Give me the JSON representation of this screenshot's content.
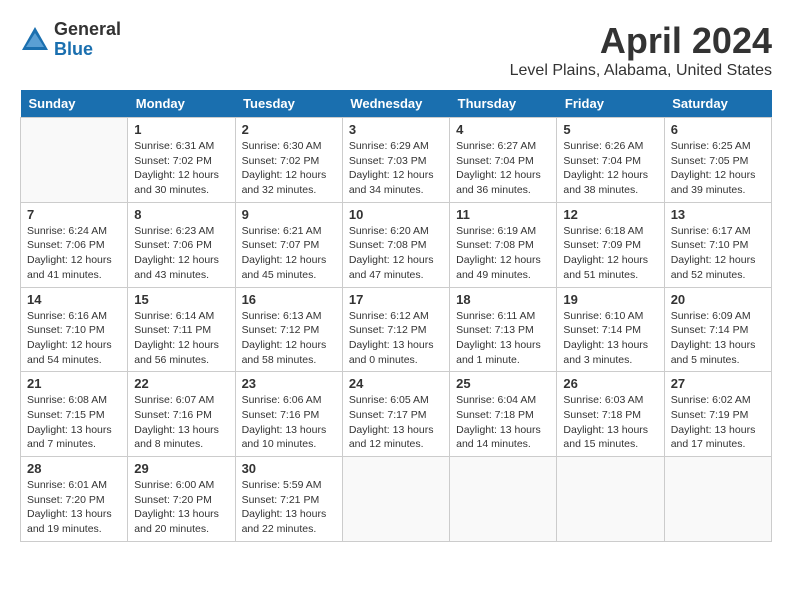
{
  "logo": {
    "general": "General",
    "blue": "Blue"
  },
  "title": "April 2024",
  "location": "Level Plains, Alabama, United States",
  "days_of_week": [
    "Sunday",
    "Monday",
    "Tuesday",
    "Wednesday",
    "Thursday",
    "Friday",
    "Saturday"
  ],
  "weeks": [
    [
      {
        "day": "",
        "sunrise": "",
        "sunset": "",
        "daylight": ""
      },
      {
        "day": "1",
        "sunrise": "Sunrise: 6:31 AM",
        "sunset": "Sunset: 7:02 PM",
        "daylight": "Daylight: 12 hours and 30 minutes."
      },
      {
        "day": "2",
        "sunrise": "Sunrise: 6:30 AM",
        "sunset": "Sunset: 7:02 PM",
        "daylight": "Daylight: 12 hours and 32 minutes."
      },
      {
        "day": "3",
        "sunrise": "Sunrise: 6:29 AM",
        "sunset": "Sunset: 7:03 PM",
        "daylight": "Daylight: 12 hours and 34 minutes."
      },
      {
        "day": "4",
        "sunrise": "Sunrise: 6:27 AM",
        "sunset": "Sunset: 7:04 PM",
        "daylight": "Daylight: 12 hours and 36 minutes."
      },
      {
        "day": "5",
        "sunrise": "Sunrise: 6:26 AM",
        "sunset": "Sunset: 7:04 PM",
        "daylight": "Daylight: 12 hours and 38 minutes."
      },
      {
        "day": "6",
        "sunrise": "Sunrise: 6:25 AM",
        "sunset": "Sunset: 7:05 PM",
        "daylight": "Daylight: 12 hours and 39 minutes."
      }
    ],
    [
      {
        "day": "7",
        "sunrise": "Sunrise: 6:24 AM",
        "sunset": "Sunset: 7:06 PM",
        "daylight": "Daylight: 12 hours and 41 minutes."
      },
      {
        "day": "8",
        "sunrise": "Sunrise: 6:23 AM",
        "sunset": "Sunset: 7:06 PM",
        "daylight": "Daylight: 12 hours and 43 minutes."
      },
      {
        "day": "9",
        "sunrise": "Sunrise: 6:21 AM",
        "sunset": "Sunset: 7:07 PM",
        "daylight": "Daylight: 12 hours and 45 minutes."
      },
      {
        "day": "10",
        "sunrise": "Sunrise: 6:20 AM",
        "sunset": "Sunset: 7:08 PM",
        "daylight": "Daylight: 12 hours and 47 minutes."
      },
      {
        "day": "11",
        "sunrise": "Sunrise: 6:19 AM",
        "sunset": "Sunset: 7:08 PM",
        "daylight": "Daylight: 12 hours and 49 minutes."
      },
      {
        "day": "12",
        "sunrise": "Sunrise: 6:18 AM",
        "sunset": "Sunset: 7:09 PM",
        "daylight": "Daylight: 12 hours and 51 minutes."
      },
      {
        "day": "13",
        "sunrise": "Sunrise: 6:17 AM",
        "sunset": "Sunset: 7:10 PM",
        "daylight": "Daylight: 12 hours and 52 minutes."
      }
    ],
    [
      {
        "day": "14",
        "sunrise": "Sunrise: 6:16 AM",
        "sunset": "Sunset: 7:10 PM",
        "daylight": "Daylight: 12 hours and 54 minutes."
      },
      {
        "day": "15",
        "sunrise": "Sunrise: 6:14 AM",
        "sunset": "Sunset: 7:11 PM",
        "daylight": "Daylight: 12 hours and 56 minutes."
      },
      {
        "day": "16",
        "sunrise": "Sunrise: 6:13 AM",
        "sunset": "Sunset: 7:12 PM",
        "daylight": "Daylight: 12 hours and 58 minutes."
      },
      {
        "day": "17",
        "sunrise": "Sunrise: 6:12 AM",
        "sunset": "Sunset: 7:12 PM",
        "daylight": "Daylight: 13 hours and 0 minutes."
      },
      {
        "day": "18",
        "sunrise": "Sunrise: 6:11 AM",
        "sunset": "Sunset: 7:13 PM",
        "daylight": "Daylight: 13 hours and 1 minute."
      },
      {
        "day": "19",
        "sunrise": "Sunrise: 6:10 AM",
        "sunset": "Sunset: 7:14 PM",
        "daylight": "Daylight: 13 hours and 3 minutes."
      },
      {
        "day": "20",
        "sunrise": "Sunrise: 6:09 AM",
        "sunset": "Sunset: 7:14 PM",
        "daylight": "Daylight: 13 hours and 5 minutes."
      }
    ],
    [
      {
        "day": "21",
        "sunrise": "Sunrise: 6:08 AM",
        "sunset": "Sunset: 7:15 PM",
        "daylight": "Daylight: 13 hours and 7 minutes."
      },
      {
        "day": "22",
        "sunrise": "Sunrise: 6:07 AM",
        "sunset": "Sunset: 7:16 PM",
        "daylight": "Daylight: 13 hours and 8 minutes."
      },
      {
        "day": "23",
        "sunrise": "Sunrise: 6:06 AM",
        "sunset": "Sunset: 7:16 PM",
        "daylight": "Daylight: 13 hours and 10 minutes."
      },
      {
        "day": "24",
        "sunrise": "Sunrise: 6:05 AM",
        "sunset": "Sunset: 7:17 PM",
        "daylight": "Daylight: 13 hours and 12 minutes."
      },
      {
        "day": "25",
        "sunrise": "Sunrise: 6:04 AM",
        "sunset": "Sunset: 7:18 PM",
        "daylight": "Daylight: 13 hours and 14 minutes."
      },
      {
        "day": "26",
        "sunrise": "Sunrise: 6:03 AM",
        "sunset": "Sunset: 7:18 PM",
        "daylight": "Daylight: 13 hours and 15 minutes."
      },
      {
        "day": "27",
        "sunrise": "Sunrise: 6:02 AM",
        "sunset": "Sunset: 7:19 PM",
        "daylight": "Daylight: 13 hours and 17 minutes."
      }
    ],
    [
      {
        "day": "28",
        "sunrise": "Sunrise: 6:01 AM",
        "sunset": "Sunset: 7:20 PM",
        "daylight": "Daylight: 13 hours and 19 minutes."
      },
      {
        "day": "29",
        "sunrise": "Sunrise: 6:00 AM",
        "sunset": "Sunset: 7:20 PM",
        "daylight": "Daylight: 13 hours and 20 minutes."
      },
      {
        "day": "30",
        "sunrise": "Sunrise: 5:59 AM",
        "sunset": "Sunset: 7:21 PM",
        "daylight": "Daylight: 13 hours and 22 minutes."
      },
      {
        "day": "",
        "sunrise": "",
        "sunset": "",
        "daylight": ""
      },
      {
        "day": "",
        "sunrise": "",
        "sunset": "",
        "daylight": ""
      },
      {
        "day": "",
        "sunrise": "",
        "sunset": "",
        "daylight": ""
      },
      {
        "day": "",
        "sunrise": "",
        "sunset": "",
        "daylight": ""
      }
    ]
  ]
}
